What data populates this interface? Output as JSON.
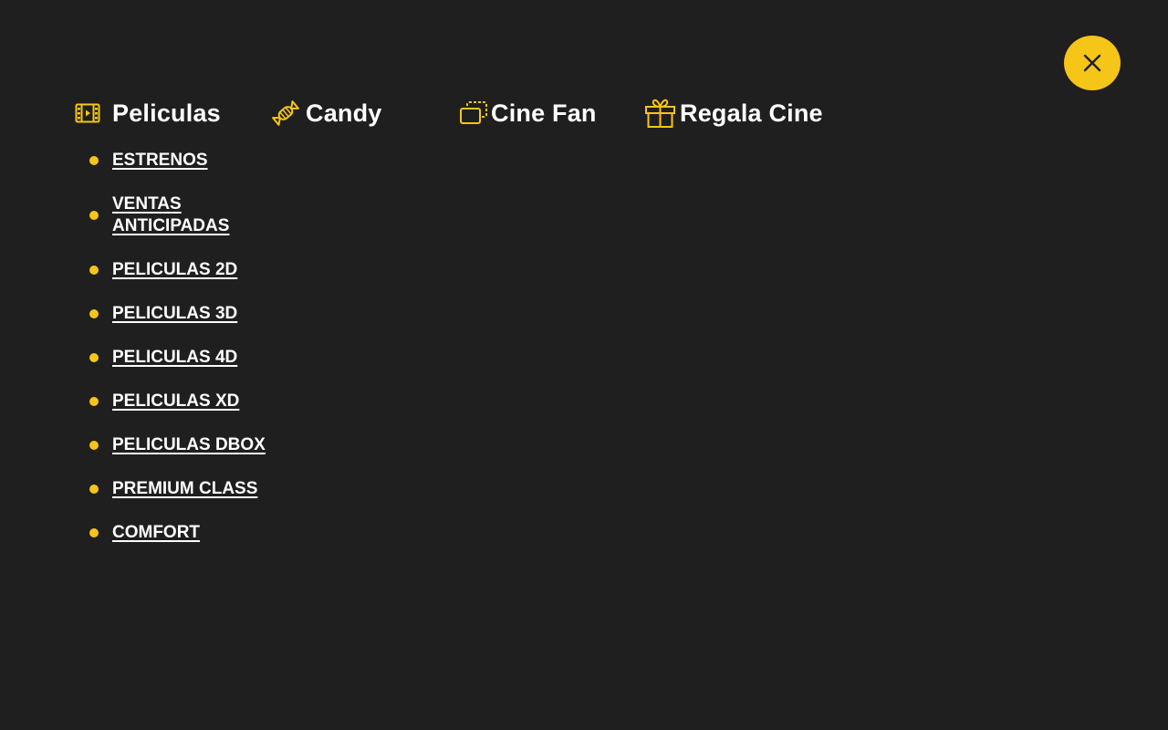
{
  "colors": {
    "background": "#1f1f1f",
    "accent": "#f5c518",
    "text": "#ffffff"
  },
  "close_button": {
    "icon": "close-icon"
  },
  "nav": {
    "columns": [
      {
        "label": "Peliculas",
        "icon": "film-icon"
      },
      {
        "label": "Candy",
        "icon": "candy-icon"
      },
      {
        "label": "Cine Fan",
        "icon": "cards-icon"
      },
      {
        "label": "Regala Cine",
        "icon": "gift-icon"
      }
    ],
    "peliculas_items": [
      "ESTRENOS",
      "VENTAS ANTICIPADAS",
      "PELICULAS 2D",
      "PELICULAS 3D",
      "PELICULAS 4D",
      "PELICULAS XD",
      "PELICULAS DBOX",
      "PREMIUM CLASS",
      "COMFORT"
    ]
  }
}
